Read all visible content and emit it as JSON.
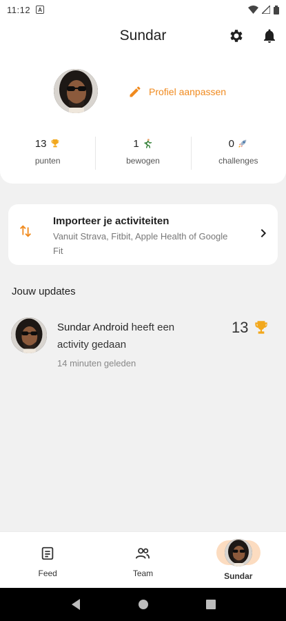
{
  "status_bar": {
    "time": "11:12",
    "notification_badge": "A"
  },
  "header": {
    "title": "Sundar",
    "icons": [
      "gear-icon",
      "bell-icon"
    ]
  },
  "profile": {
    "edit_label": "Profiel aanpassen"
  },
  "stats": [
    {
      "value": "13",
      "icon": "trophy-icon",
      "label": "punten"
    },
    {
      "value": "1",
      "icon": "runner-icon",
      "label": "bewogen"
    },
    {
      "value": "0",
      "icon": "rocket-icon",
      "label": "challenges"
    }
  ],
  "import_card": {
    "title": "Importeer je activiteiten",
    "subtitle": "Vanuit Strava, Fitbit, Apple Health of Google Fit"
  },
  "updates": {
    "section_title": "Jouw updates",
    "items": [
      {
        "user": "Sundar Android",
        "action": " heeft een activity gedaan",
        "time": "14 minuten geleden",
        "points": "13"
      }
    ]
  },
  "bottom_nav": {
    "items": [
      {
        "label": "Feed",
        "icon": "document-icon"
      },
      {
        "label": "Team",
        "icon": "people-icon"
      },
      {
        "label": "Sundar",
        "icon": "avatar",
        "active": true
      }
    ]
  },
  "colors": {
    "accent": "#f08a1e",
    "active_pill": "#fcdcc0",
    "background": "#f1f1f1"
  }
}
